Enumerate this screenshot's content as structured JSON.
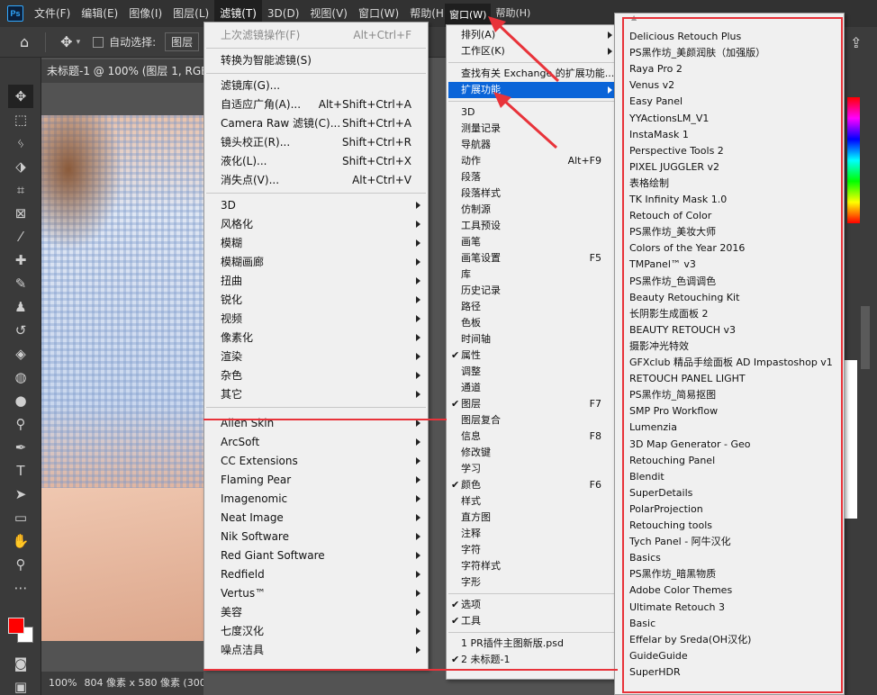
{
  "app": {
    "logo": "Ps"
  },
  "menubar": [
    "文件(F)",
    "编辑(E)",
    "图像(I)",
    "图层(L)",
    "滤镜(T)",
    "3D(D)",
    "视图(V)",
    "窗口(W)",
    "帮助(H)"
  ],
  "menubar2": [
    "窗口(W)",
    "帮助(H)"
  ],
  "options": {
    "auto_select": "自动选择:",
    "combo": "图层"
  },
  "document": {
    "tab": "未标题-1 @ 100% (图层 1, RGB/8) *"
  },
  "status": {
    "zoom": "100%",
    "size": "804 像素 x 580 像素 (300 ppi)"
  },
  "filter_menu": {
    "top": [
      {
        "label": "上次滤镜操作(F)",
        "shortcut": "Alt+Ctrl+F",
        "disabled": true
      },
      {
        "label": "转换为智能滤镜(S)"
      },
      {
        "label": "滤镜库(G)..."
      },
      {
        "label": "自适应广角(A)...",
        "shortcut": "Alt+Shift+Ctrl+A"
      },
      {
        "label": "Camera Raw 滤镜(C)...",
        "shortcut": "Shift+Ctrl+A"
      },
      {
        "label": "镜头校正(R)...",
        "shortcut": "Shift+Ctrl+R"
      },
      {
        "label": "液化(L)...",
        "shortcut": "Shift+Ctrl+X"
      },
      {
        "label": "消失点(V)...",
        "shortcut": "Alt+Ctrl+V"
      }
    ],
    "groups": [
      "3D",
      "风格化",
      "模糊",
      "模糊画廊",
      "扭曲",
      "锐化",
      "视频",
      "像素化",
      "渲染",
      "杂色",
      "其它"
    ],
    "plugins": [
      "Alien Skin",
      "ArcSoft",
      "CC Extensions",
      "Flaming Pear",
      "Imagenomic",
      "Neat Image",
      "Nik Software",
      "Red Giant Software",
      "Redfield",
      "Vertus™",
      "美容",
      "七度汉化",
      "噪点洁具"
    ]
  },
  "window_menu": {
    "items": [
      {
        "label": "排列(A)",
        "sub": true
      },
      {
        "label": "工作区(K)",
        "sub": true
      },
      {
        "label": "查找有关 Exchange 的扩展功能...",
        "sep_before": true
      },
      {
        "label": "扩展功能",
        "sub": true,
        "highlight": true
      },
      {
        "label": "3D",
        "sep_before": true
      },
      {
        "label": "测量记录"
      },
      {
        "label": "导航器"
      },
      {
        "label": "动作",
        "shortcut": "Alt+F9"
      },
      {
        "label": "段落"
      },
      {
        "label": "段落样式"
      },
      {
        "label": "仿制源"
      },
      {
        "label": "工具预设"
      },
      {
        "label": "画笔"
      },
      {
        "label": "画笔设置",
        "shortcut": "F5"
      },
      {
        "label": "库"
      },
      {
        "label": "历史记录"
      },
      {
        "label": "路径"
      },
      {
        "label": "色板"
      },
      {
        "label": "时间轴"
      },
      {
        "label": "属性",
        "checked": true
      },
      {
        "label": "调整"
      },
      {
        "label": "通道"
      },
      {
        "label": "图层",
        "shortcut": "F7",
        "checked": true
      },
      {
        "label": "图层复合"
      },
      {
        "label": "信息",
        "shortcut": "F8"
      },
      {
        "label": "修改键"
      },
      {
        "label": "学习"
      },
      {
        "label": "颜色",
        "shortcut": "F6",
        "checked": true
      },
      {
        "label": "样式"
      },
      {
        "label": "直方图"
      },
      {
        "label": "注释"
      },
      {
        "label": "字符"
      },
      {
        "label": "字符样式"
      },
      {
        "label": "字形"
      },
      {
        "label": "选项",
        "checked": true,
        "sep_before": true
      },
      {
        "label": "工具",
        "checked": true
      },
      {
        "label": "1 PR插件主图新版.psd",
        "sep_before": true
      },
      {
        "label": "2 未标题-1",
        "checked": true
      }
    ]
  },
  "extensions": [
    "Delicious Retouch Plus",
    "PS黑作坊_美颜润肤（加强版）",
    "Raya Pro 2",
    "Venus v2",
    "Easy Panel",
    "YYActionsLM_V1",
    "InstaMask 1",
    "Perspective Tools 2",
    "PIXEL JUGGLER v2",
    "表格绘制",
    "TK Infinity Mask 1.0",
    "Retouch of Color",
    "PS黑作坊_美妆大师",
    "Colors of the Year 2016",
    "TMPanel™ v3",
    "PS黑作坊_色调调色",
    "Beauty Retouching Kit",
    "长阴影生成面板 2",
    "BEAUTY RETOUCH v3",
    "摄影冲光特效",
    "GFXclub 精品手绘面板 AD Impastoshop v1",
    "RETOUCH PANEL LIGHT",
    "PS黑作坊_简易抠图",
    "SMP Pro Workflow",
    "Lumenzia",
    "3D Map Generator - Geo",
    "Retouching Panel",
    "Blendit",
    "SuperDetails",
    "PolarProjection",
    "Retouching tools",
    "Tych Panel - 阿牛汉化",
    "Basics",
    "PS黑作坊_暗黑物质",
    "Adobe Color Themes",
    "Ultimate Retouch 3",
    "Basic",
    "Effelar by Sreda(OH汉化)",
    "GuideGuide",
    "SuperHDR"
  ],
  "colors": {
    "highlight": "#0a64d8",
    "annotation": "#e8333a",
    "foreground": "#ff0000",
    "background": "#ffffff"
  }
}
